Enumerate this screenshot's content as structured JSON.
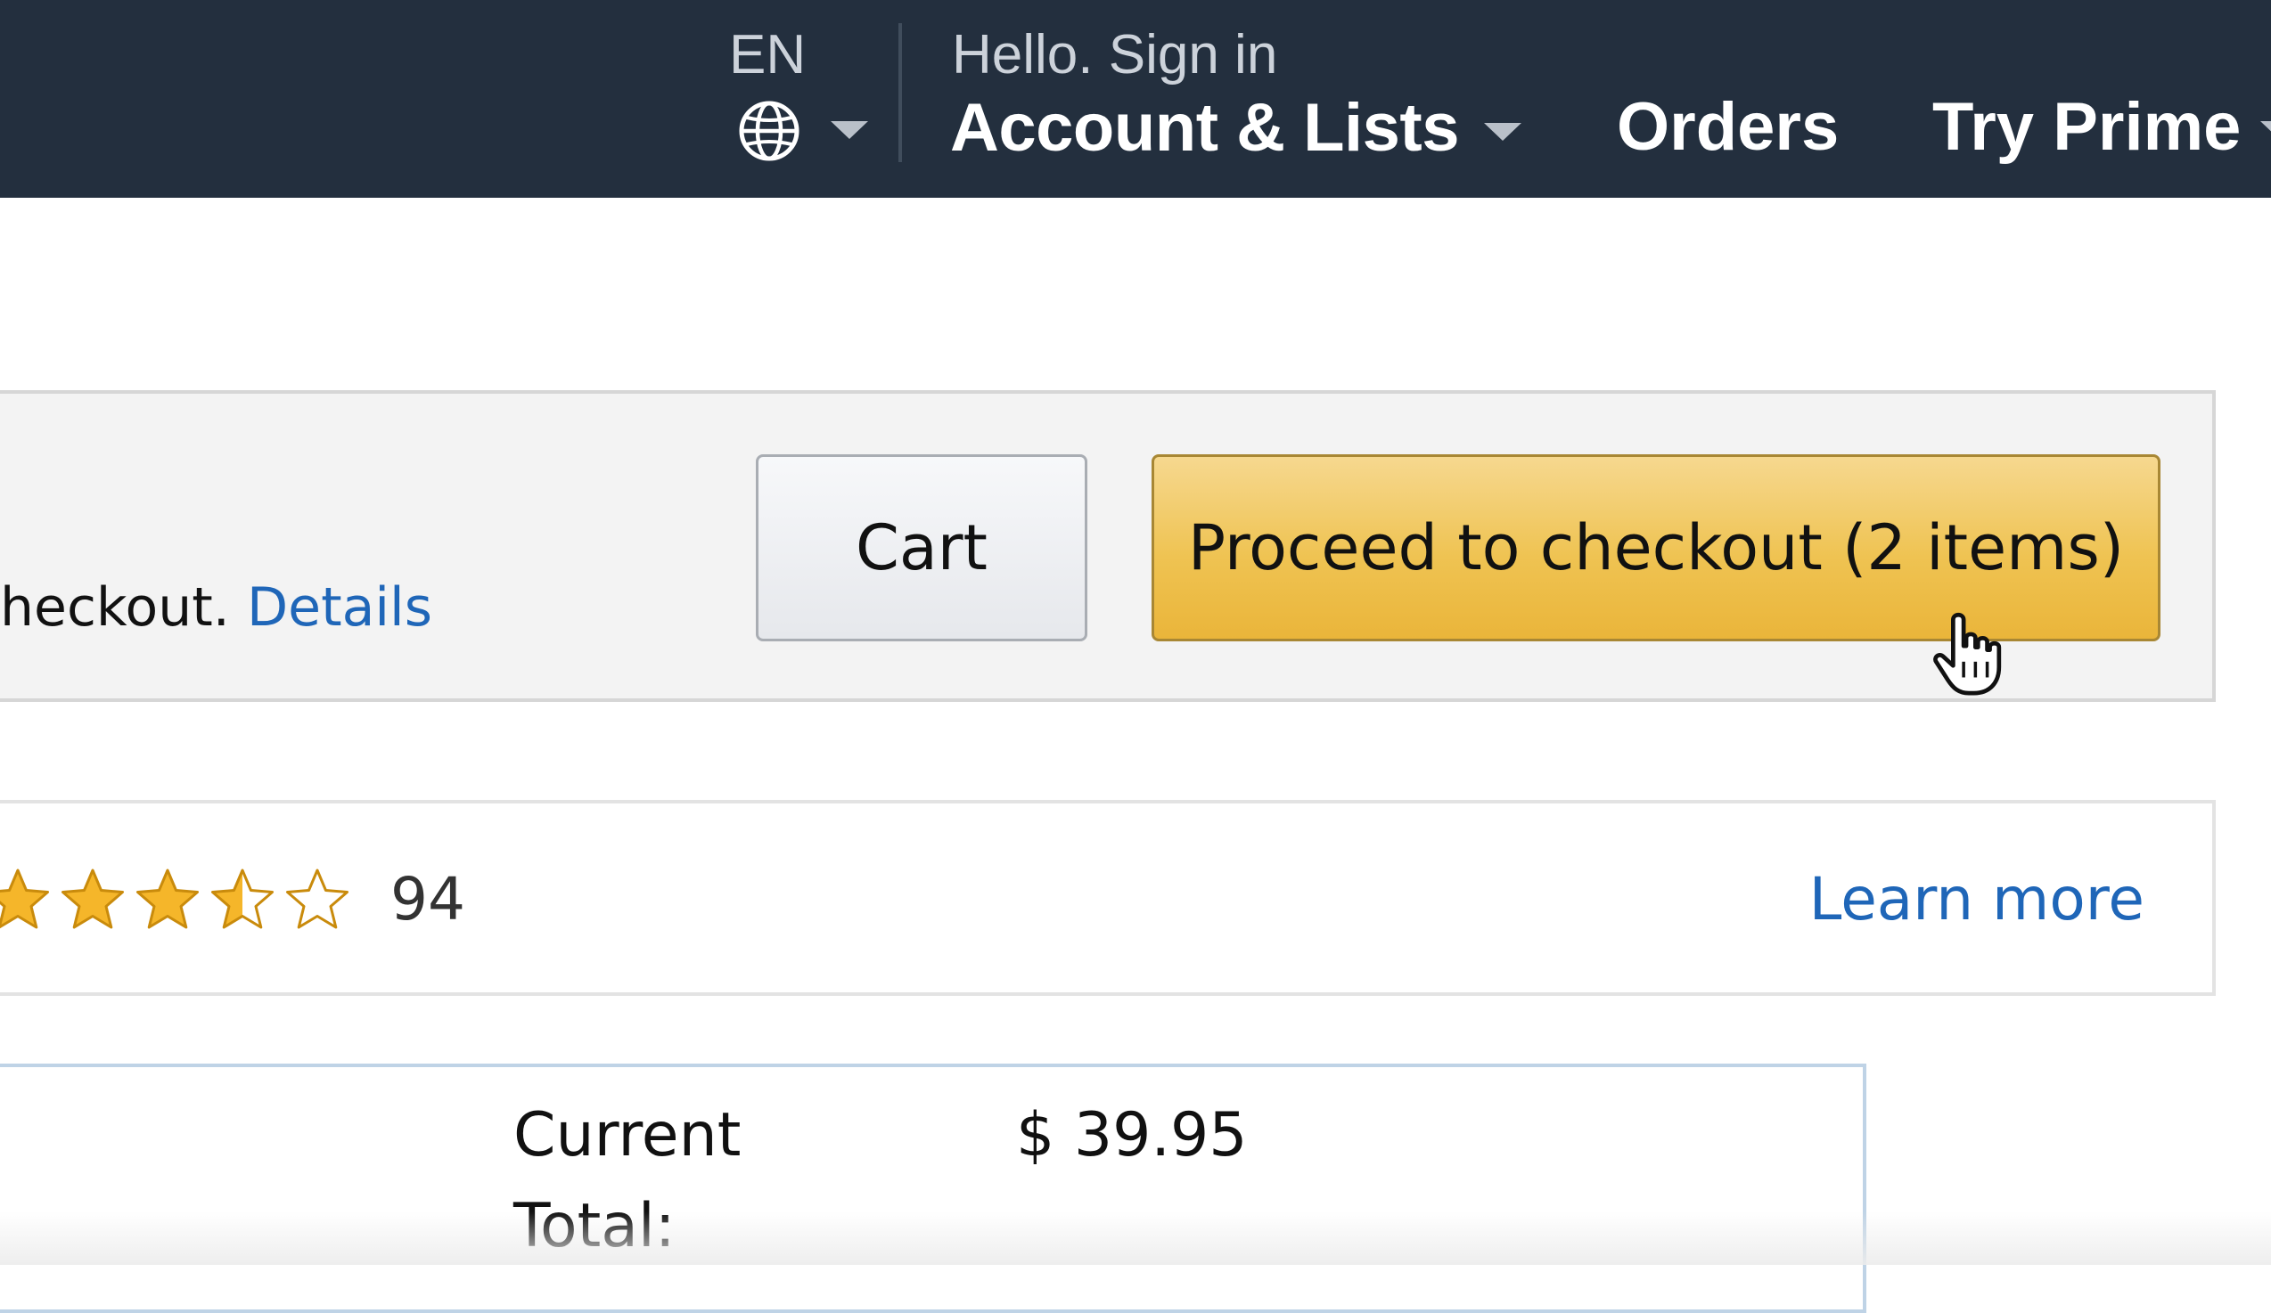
{
  "nav": {
    "language": "EN",
    "greeting": "Hello. Sign in",
    "account_label": "Account & Lists",
    "orders_label": "Orders",
    "prime_label": "Try Prime",
    "icons": {
      "language": "globe-icon",
      "dropdown": "caret-down-icon"
    },
    "colors": {
      "bar": "#232f3e",
      "text": "#ffffff"
    }
  },
  "checkout": {
    "note_text": "heckout.",
    "details_link": "Details",
    "cart_button": "Cart",
    "checkout_button": "Proceed to checkout (2 items)",
    "colors": {
      "checkout_button": "#efc352",
      "link": "#1f66b8"
    }
  },
  "reviews": {
    "rating": 3.5,
    "max_rating": 5,
    "count": "94",
    "learn_more": "Learn more"
  },
  "order_total": {
    "label": "Current Total:",
    "value": "$ 39.95"
  }
}
